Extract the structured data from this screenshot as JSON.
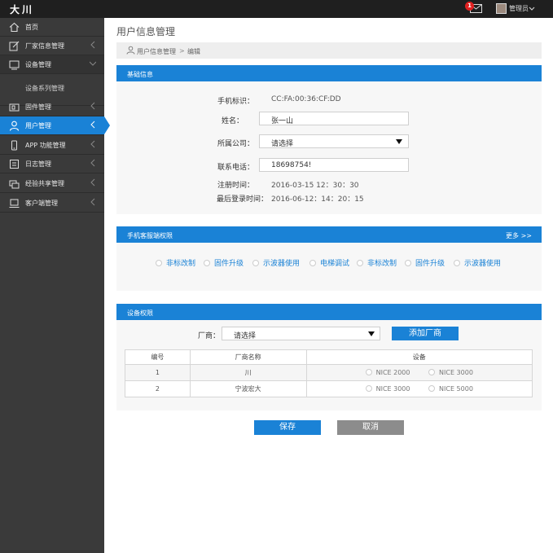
{
  "header": {
    "brand": "大川",
    "notification_count": "1",
    "user_name": "管理员"
  },
  "sidebar": {
    "items": [
      {
        "label": "首页",
        "icon": "home-icon"
      },
      {
        "label": "厂家信息管理",
        "icon": "edit-icon"
      },
      {
        "label": "设备管理",
        "icon": "device-icon"
      },
      {
        "label": "设备系列管理",
        "icon": ""
      },
      {
        "label": "固件管理",
        "icon": "firmware-icon"
      },
      {
        "label": "用户管理",
        "icon": "user-icon"
      },
      {
        "label": "APP 功能管理",
        "icon": "phone-icon"
      },
      {
        "label": "日志管理",
        "icon": "log-icon"
      },
      {
        "label": "经验共享管理",
        "icon": "share-icon"
      },
      {
        "label": "客户端管理",
        "icon": "client-icon"
      }
    ]
  },
  "page": {
    "title": "用户信息管理",
    "breadcrumb": {
      "root": "用户信息管理",
      "sep": ">",
      "current": "编辑"
    }
  },
  "basic": {
    "title": "基础信息",
    "phone_id_label": "手机标识：",
    "phone_id_value": "CC:FA:00:36:CF:DD",
    "name_label": "姓名：",
    "name_value": "张一山",
    "company_label": "所属公司：",
    "company_value": "请选择",
    "phone_label": "联系电话：",
    "phone_value": "18698754!",
    "reg_label": "注册时间：",
    "reg_value": "2016-03-15 12：30：30",
    "login_label": "最后登录时间：",
    "login_value": "2016-06-12：14：20：15"
  },
  "mobile_perm": {
    "title": "手机客服端权限",
    "more": "更多 >>",
    "options": [
      "非标改制",
      "固件升级",
      "示波器使用",
      "电梯调试",
      "非标改制",
      "固件升级",
      "示波器使用"
    ]
  },
  "device_perm": {
    "title": "设备权限",
    "vendor_label": "厂商：",
    "vendor_value": "请选择",
    "add_button": "添加厂商",
    "columns": [
      "编号",
      "厂商名称",
      "设备"
    ],
    "rows": [
      {
        "no": "1",
        "vendor": "川",
        "devices": [
          "NICE 2000",
          "NICE 3000"
        ]
      },
      {
        "no": "2",
        "vendor": "宁波宏大",
        "devices": [
          "NICE 3000",
          "NICE 5000"
        ]
      }
    ]
  },
  "actions": {
    "save": "保存",
    "cancel": "取消"
  },
  "colors": {
    "accent": "#1a82d6",
    "sidebar": "#3a3a3a",
    "topbar": "#1f1f1f",
    "cancel": "#8c8c8c"
  }
}
